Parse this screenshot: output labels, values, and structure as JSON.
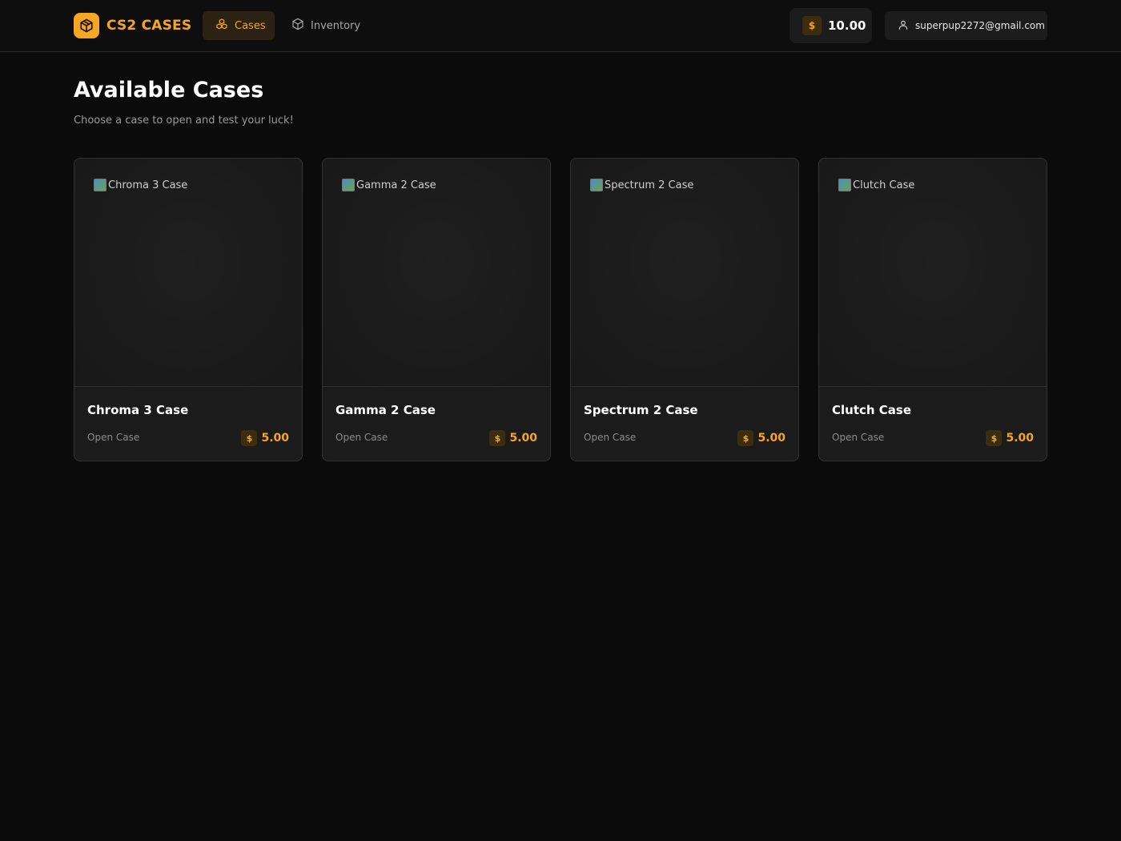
{
  "navbar": {
    "brand": "CS2 CASES",
    "tabs": [
      {
        "label": "Cases",
        "icon": "cubes-icon",
        "active": true
      },
      {
        "label": "Inventory",
        "icon": "box-icon",
        "active": false
      }
    ],
    "balance": {
      "currency_symbol": "$",
      "value": "10.00"
    },
    "user": {
      "email": "superpup2272@gmail.com",
      "icon": "user-icon"
    }
  },
  "main": {
    "title": "Available Cases",
    "subtitle": "Choose a case to open and test your luck!"
  },
  "cases": [
    {
      "name": "Chroma 3 Case",
      "image_alt": "Chroma 3 Case",
      "action": "Open Case",
      "currency_symbol": "$",
      "price": "5.00"
    },
    {
      "name": "Gamma 2 Case",
      "image_alt": "Gamma 2 Case",
      "action": "Open Case",
      "currency_symbol": "$",
      "price": "5.00"
    },
    {
      "name": "Spectrum 2 Case",
      "image_alt": "Spectrum 2 Case",
      "action": "Open Case",
      "currency_symbol": "$",
      "price": "5.00"
    },
    {
      "name": "Clutch Case",
      "image_alt": "Clutch Case",
      "action": "Open Case",
      "currency_symbol": "$",
      "price": "5.00"
    }
  ],
  "colors": {
    "accent": "#f5a623",
    "background": "#0b0b0b",
    "card": "#1b1b1b"
  }
}
